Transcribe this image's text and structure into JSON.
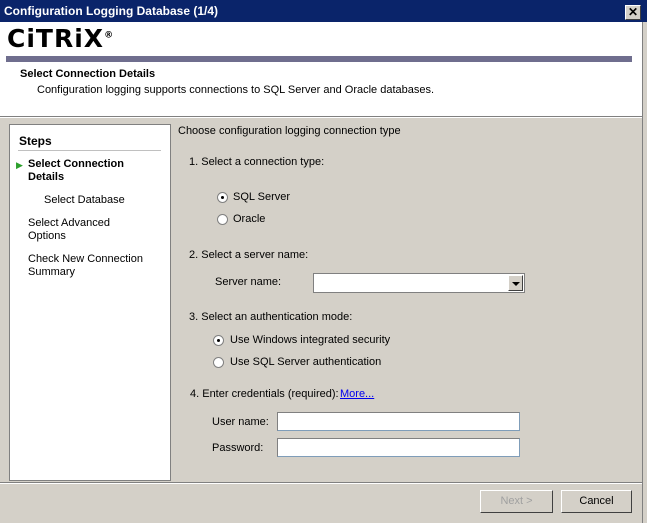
{
  "window": {
    "title": "Configuration Logging Database (1/4)",
    "close_glyph": "✕"
  },
  "header": {
    "logo": "CiTRiX",
    "logo_mark": "®",
    "title": "Select Connection Details",
    "subtitle": "Configuration logging supports connections to SQL Server and Oracle databases."
  },
  "steps": {
    "heading": "Steps",
    "items": [
      {
        "label": "Select Connection Details",
        "active": true,
        "arrow": "▶"
      },
      {
        "label": "Select Database",
        "active": false
      },
      {
        "label": "Select Advanced Options",
        "active": false
      },
      {
        "label": "Check New Connection Summary",
        "active": false
      }
    ]
  },
  "main": {
    "title": "Choose configuration logging connection type",
    "section1": {
      "label": "1. Select a connection type:",
      "options": [
        {
          "label": "SQL Server",
          "checked": true
        },
        {
          "label": "Oracle",
          "checked": false
        }
      ]
    },
    "section2": {
      "label": "2. Select a server name:",
      "field_label": "Server name:",
      "value": ""
    },
    "section3": {
      "label": "3. Select an authentication mode:",
      "options": [
        {
          "label": "Use Windows integrated security",
          "checked": true
        },
        {
          "label": "Use SQL Server authentication",
          "checked": false
        }
      ]
    },
    "section4": {
      "label": "4. Enter credentials (required):",
      "more_link": "More...",
      "username_label": "User name:",
      "username_value": "",
      "password_label": "Password:",
      "password_value": ""
    }
  },
  "footer": {
    "next_label": "Next >",
    "next_enabled": false,
    "cancel_label": "Cancel"
  },
  "colors": {
    "titlebar": "#0a246a",
    "accent_bar": "#6f6e8e",
    "dialog_bg": "#d4d0c8",
    "step_arrow": "#2ca02c"
  }
}
